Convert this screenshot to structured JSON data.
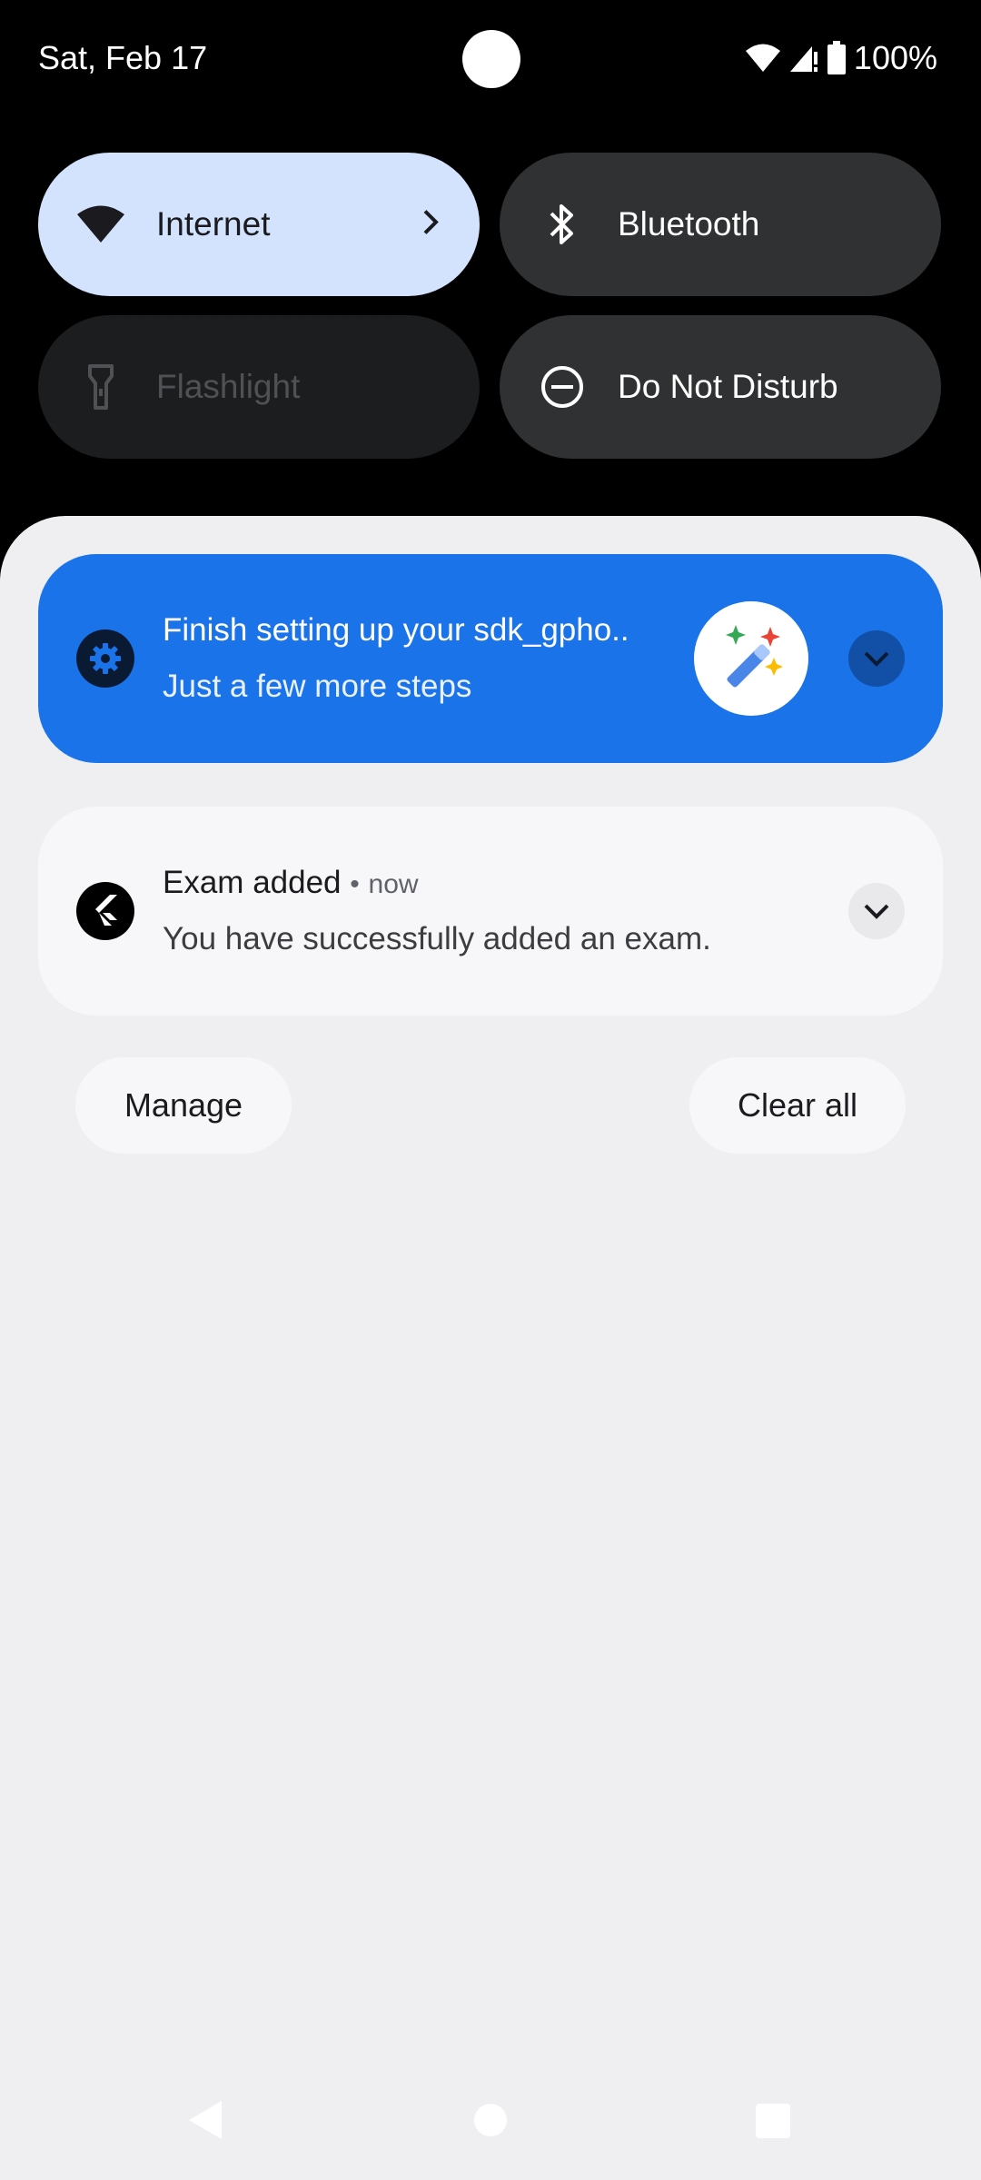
{
  "status_bar": {
    "date": "Sat, Feb 17",
    "battery": "100%",
    "icons": [
      "wifi-icon",
      "cell-signal-icon",
      "battery-icon"
    ]
  },
  "quick_settings": {
    "tiles": [
      {
        "label": "Internet",
        "icon": "wifi-icon",
        "state": "on"
      },
      {
        "label": "Bluetooth",
        "icon": "bluetooth-icon",
        "state": "off"
      },
      {
        "label": "Flashlight",
        "icon": "flashlight-icon",
        "state": "unavailable"
      },
      {
        "label": "Do Not Disturb",
        "icon": "do-not-disturb-icon",
        "state": "off"
      }
    ]
  },
  "notifications": [
    {
      "app_icon": "gear-icon",
      "title": "Finish setting up your sdk_gpho..",
      "text": "Just a few more steps",
      "badge_icon": "magic-wand-icon",
      "color": "#1a73e8"
    },
    {
      "app_icon": "flutter-icon",
      "title": "Exam added",
      "separator": "•",
      "time": "now",
      "text": "You have successfully added an exam."
    }
  ],
  "actions": {
    "manage": "Manage",
    "clear_all": "Clear all"
  },
  "colors": {
    "accent": "#1a73e8",
    "tile_active": "#d3e3fd",
    "tile_inactive": "#2f3133",
    "shade_background": "#efeff1"
  }
}
